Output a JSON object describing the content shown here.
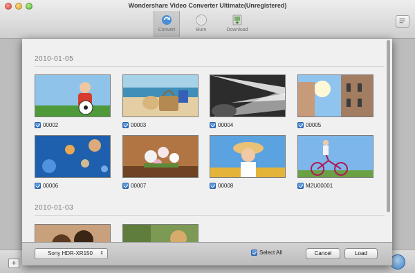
{
  "window": {
    "title": "Wondershare Video Converter Ultimate(Unregistered)",
    "tabs": [
      {
        "label": "Convert",
        "icon": "convert-tab-icon",
        "active": true
      },
      {
        "label": "Burn",
        "icon": "disc-icon",
        "active": false
      },
      {
        "label": "Download",
        "icon": "download-icon",
        "active": false
      }
    ]
  },
  "dialog": {
    "groups": [
      {
        "date": "2010-01-05",
        "items": [
          {
            "name": "00002",
            "checked": true
          },
          {
            "name": "00003",
            "checked": true
          },
          {
            "name": "00004",
            "checked": true
          },
          {
            "name": "00005",
            "checked": true
          },
          {
            "name": "00006",
            "checked": true
          },
          {
            "name": "00007",
            "checked": true
          },
          {
            "name": "00008",
            "checked": true
          },
          {
            "name": "M2U00001",
            "checked": true
          }
        ]
      },
      {
        "date": "2010-01-03",
        "items": []
      }
    ],
    "footer": {
      "device": "Sony HDR-XR150",
      "select_all_label": "Select All",
      "select_all_checked": true,
      "cancel_label": "Cancel",
      "load_label": "Load"
    }
  },
  "colors": {
    "checkbox": "#2f6fc4",
    "window_bg": "#bdbdbd",
    "sheet_bg": "#f0f0f0"
  }
}
